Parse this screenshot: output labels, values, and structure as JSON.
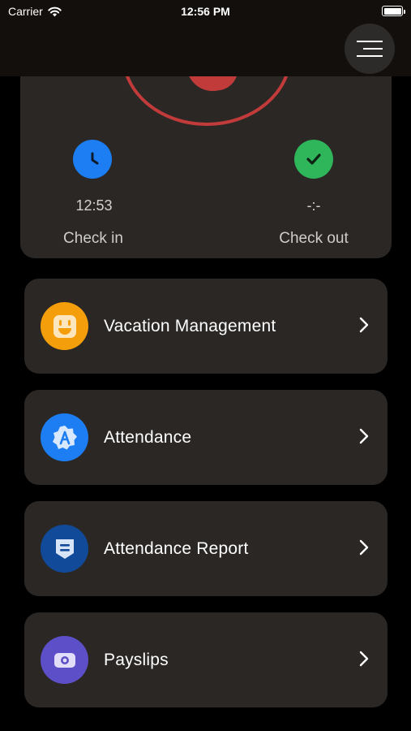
{
  "status_bar": {
    "carrier": "Carrier",
    "time": "12:56 PM",
    "icons": [
      "wifi-icon",
      "battery-icon"
    ]
  },
  "header": {
    "menu_icon": "hamburger-menu-icon"
  },
  "attendance_card": {
    "check_in": {
      "value": "12:53",
      "label": "Check in",
      "icon": "clock-icon",
      "color": "#1c7ef2"
    },
    "check_out": {
      "value": "-:-",
      "label": "Check out",
      "icon": "checkmark-icon",
      "color": "#2fb65b"
    },
    "accent_color": "#c23b3b"
  },
  "menu": [
    {
      "label": "Vacation Management",
      "icon": "smiley-face-icon",
      "color": "#f59e0b"
    },
    {
      "label": "Attendance",
      "icon": "badge-a-icon",
      "color": "#1c7ef2"
    },
    {
      "label": "Attendance Report",
      "icon": "report-shield-icon",
      "color": "#104a98"
    },
    {
      "label": "Payslips",
      "icon": "money-bill-icon",
      "color": "#5d4fc8"
    }
  ]
}
